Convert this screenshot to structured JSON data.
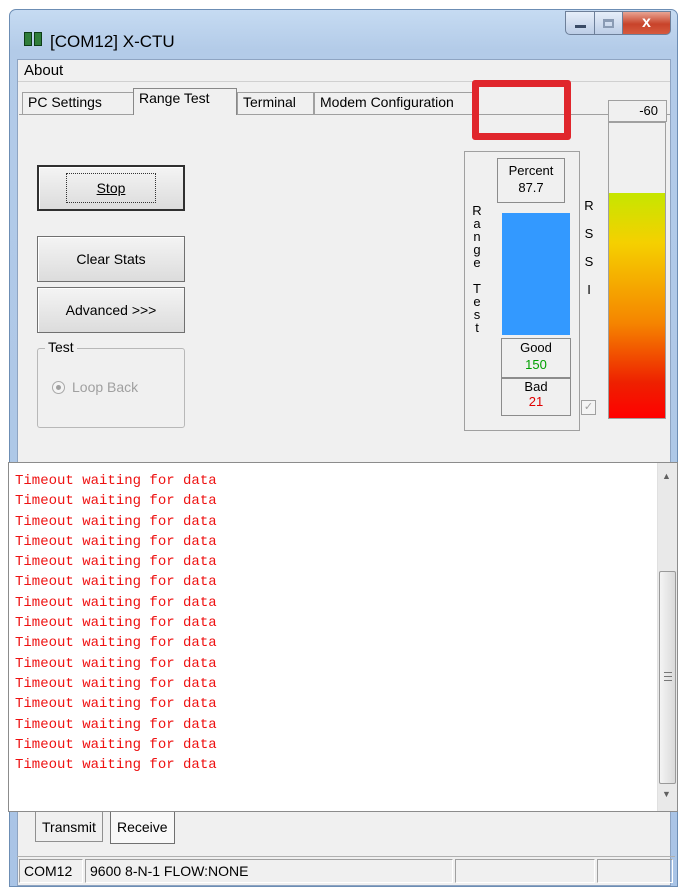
{
  "window": {
    "title": "[COM12] X-CTU",
    "close_glyph": "x"
  },
  "menu": {
    "about": "About"
  },
  "tabs": [
    {
      "label": "PC Settings"
    },
    {
      "label": "Range Test"
    },
    {
      "label": "Terminal"
    },
    {
      "label": "Modem Configuration"
    }
  ],
  "range_test": {
    "stop_label": "Stop",
    "clear_stats_label": "Clear Stats",
    "advanced_label": "Advanced >>>",
    "test_group_label": "Test",
    "loop_back_label": "Loop Back",
    "percent_label": "Percent",
    "percent_value": "87.7",
    "good_label": "Good",
    "good_value": "150",
    "bad_label": "Bad",
    "bad_value": "21",
    "side_label_letters": [
      "R",
      "a",
      "n",
      "g",
      "e",
      "",
      "T",
      "e",
      "s",
      "t"
    ],
    "rssi_letters": [
      "R",
      "S",
      "S",
      "I"
    ],
    "rssi_value": "-60",
    "bar_color": "#3399ff",
    "highlight_color": "#e0262c"
  },
  "log": {
    "lines": [
      "Timeout waiting for data",
      "Timeout waiting for data",
      "Timeout waiting for data",
      "Timeout waiting for data",
      "Timeout waiting for data",
      "Timeout waiting for data",
      "Timeout waiting for data",
      "Timeout waiting for data",
      "Timeout waiting for data",
      "Timeout waiting for data",
      "Timeout waiting for data",
      "Timeout waiting for data",
      "Timeout waiting for data",
      "Timeout waiting for data",
      "Timeout waiting for data"
    ],
    "text_color": "#ee1111"
  },
  "bottom_tabs": {
    "transmit": "Transmit",
    "receive": "Receive"
  },
  "status": {
    "port": "COM12",
    "settings": "9600 8-N-1  FLOW:NONE"
  }
}
